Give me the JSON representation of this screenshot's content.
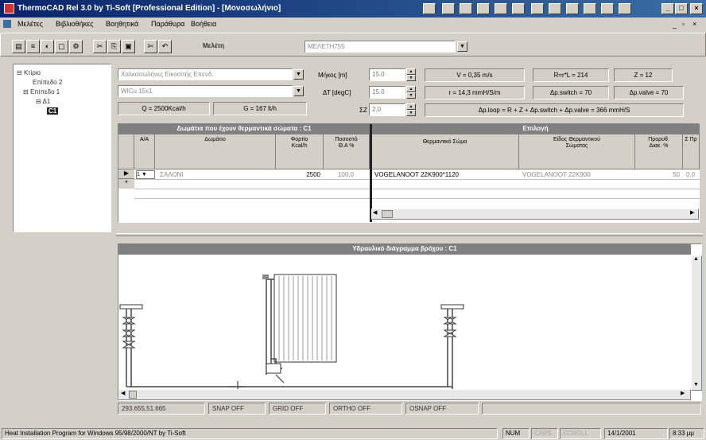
{
  "window": {
    "title": "ThermoCAD Rel 3.0 by Ti-Soft  [Professional Edition] - [Μονοσωλήνιο]",
    "minimize": "_",
    "maximize": "□",
    "close": "×"
  },
  "menu": {
    "items": [
      "Μελέτες",
      "Βιβλιοθήκες",
      "Βοηθητικά",
      "Παράθυρα",
      "Βοήθεια"
    ]
  },
  "toolbar": {
    "study_label": "Μελέτη",
    "study_value": "ΜΕΛΕΤΗ755"
  },
  "params": {
    "pipe_type": "Χαλκοσωλήνες Εικοσιτής Επενδ.",
    "pipe_size": "WICu 15x1",
    "q_value": "Q = 2500Kcal/h",
    "g_value": "G = 167 lt/h",
    "length_label": "Μήκος [m]",
    "length_value": "15.0",
    "dt_label": "ΔΤ [degC]",
    "dt_value": "15.0",
    "sigma_label": "ΣZ",
    "sigma_value": "2.0",
    "velocity": "V = 0,35 m/s",
    "friction": "r = 14,3 mmH/S/m",
    "rl": "R=r*L = 214",
    "z": "Z = 12",
    "dp_switch": "Δp.switch = 70",
    "dp_valve": "Δp.valve = 70",
    "dp_loop": "Δp.loop = R + Z + Δp.switch + Δp.valve = 366 mmH/S"
  },
  "tree": {
    "nodes": [
      "Κτίριο",
      "Επίπεδο 2",
      "Επίπεδο 1",
      "Δ1",
      "C1"
    ]
  },
  "grid": {
    "title_left": "Δωμάτια που έχουν θερμαντικά σώματα : C1",
    "title_right": "Επιλογή",
    "headers": [
      "Α/Α",
      "Δωμάτιο",
      "Φορτίο Kcal/h",
      "Ποσοστό Θ.Α %",
      "Θερμαντικό Σώμα",
      "Είδος Θερμαντικού Σώματος",
      "Προρυθ. Διακ. %",
      "Σ Πρ"
    ],
    "row": {
      "aa": "1",
      "room": "ΣΑΛΟΝΙ",
      "load": "2500",
      "percent": "100,0",
      "radiator": "VOGELANOOT 22K900*1120",
      "radiator_type": "VOGELANOOT 22K900",
      "preset": "50",
      "extra": "0,0"
    }
  },
  "drawing": {
    "title": "Υδραυλικό διάγραμμα βρόχου : C1"
  },
  "status_row": {
    "coords": "293.655,51.665",
    "snap": "SNAP OFF",
    "grid": "GRID OFF",
    "ortho": "ORTHO OFF",
    "osnap": "OSNAP OFF"
  },
  "app_status": {
    "message": "Heat Installation Program  for Windows 95/98/2000/NT  by Ti-Soft",
    "num": "NUM",
    "caps": "CAPS",
    "scroll": "SCROLL",
    "date": "14/1/2001",
    "time": "8:33 μμ"
  }
}
